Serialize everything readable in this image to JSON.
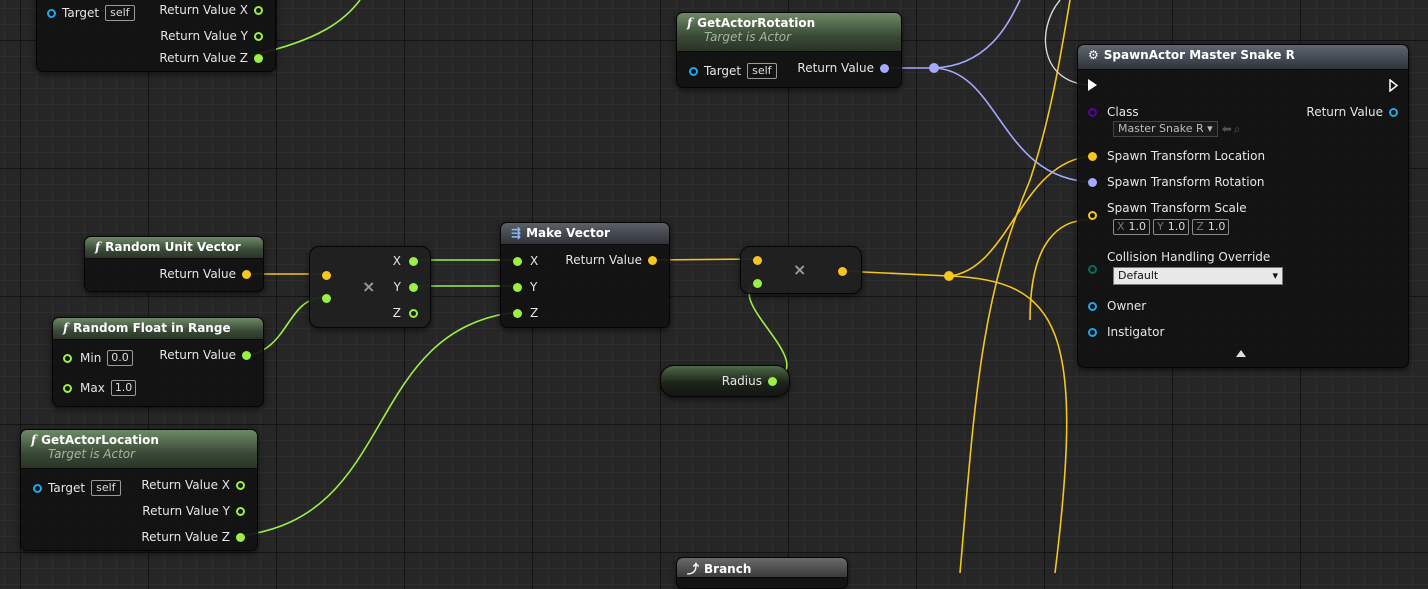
{
  "colors": {
    "float": "#9cef45",
    "vector": "#f5c61f",
    "rotator": "#a3aaff",
    "object": "#1fa7e8",
    "class": "#5c00a3",
    "enum": "#0a6b5c",
    "exec": "#ffffff"
  },
  "nodes": {
    "top_left": {
      "pin_target": "Target",
      "self": "self",
      "out_x": "Return Value X",
      "out_y": "Return Value Y",
      "out_z": "Return Value Z"
    },
    "get_actor_rotation": {
      "icon": "function-icon",
      "title": "GetActorRotation",
      "subtitle": "Target is Actor",
      "pin_target": "Target",
      "self": "self",
      "out": "Return Value"
    },
    "spawn_actor": {
      "icon": "spawn-icon",
      "title": "SpawnActor Master Snake R",
      "class_label": "Class",
      "class_value": "Master Snake R",
      "return_label": "Return Value",
      "location_label": "Spawn Transform Location",
      "rotation_label": "Spawn Transform Rotation",
      "scale_label": "Spawn Transform Scale",
      "scale_x_axis": "X",
      "scale_x": "1.0",
      "scale_y_axis": "Y",
      "scale_y": "1.0",
      "scale_z_axis": "Z",
      "scale_z": "1.0",
      "collision_label": "Collision Handling Override",
      "collision_value": "Default",
      "owner_label": "Owner",
      "instigator_label": "Instigator"
    },
    "random_unit_vector": {
      "icon": "function-icon",
      "title": "Random Unit Vector",
      "out": "Return Value"
    },
    "random_float": {
      "icon": "function-icon",
      "title": "Random Float in Range",
      "min_label": "Min",
      "min_value": "0.0",
      "max_label": "Max",
      "max_value": "1.0",
      "out": "Return Value"
    },
    "multiply_left": {
      "out_x": "X",
      "out_y": "Y",
      "out_z": "Z"
    },
    "make_vector": {
      "icon": "struct-icon",
      "title": "Make Vector",
      "in_x": "X",
      "in_y": "Y",
      "in_z": "Z",
      "out": "Return Value"
    },
    "radius": {
      "label": "Radius"
    },
    "get_actor_location": {
      "icon": "function-icon",
      "title": "GetActorLocation",
      "subtitle": "Target is Actor",
      "pin_target": "Target",
      "self": "self",
      "out_x": "Return Value X",
      "out_y": "Return Value Y",
      "out_z": "Return Value Z"
    },
    "branch": {
      "icon": "branch-icon",
      "title": "Branch"
    }
  }
}
